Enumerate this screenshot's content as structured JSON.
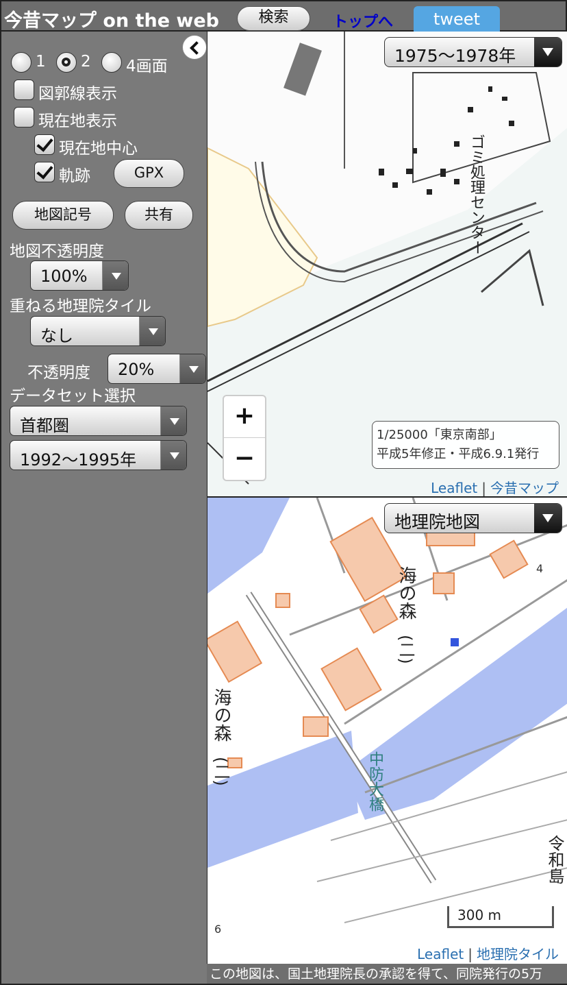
{
  "header": {
    "title": "今昔マップ on the web",
    "search_label": "検索",
    "top_link_label": "トップへ",
    "tweet_label": "tweet"
  },
  "sidebar": {
    "screen_options": [
      "1",
      "2",
      "4画面"
    ],
    "selected_screens": "2",
    "graticule_label": "図郭線表示",
    "graticule_checked": false,
    "location_label": "現在地表示",
    "location_checked": false,
    "center_label": "現在地中心",
    "center_checked": true,
    "track_label": "軌跡",
    "track_checked": true,
    "gpx_label": "GPX",
    "map_symbols_label": "地図記号",
    "share_label": "共有",
    "opacity_heading": "地図不透明度",
    "opacity_value": "100%",
    "overlay_heading": "重ねる地理院タイル",
    "overlay_value": "なし",
    "overlay_opacity_label": "不透明度",
    "overlay_opacity_value": "20%",
    "dataset_heading": "データセット選択",
    "dataset_value": "首都圏",
    "period_value": "1992〜1995年"
  },
  "map_top": {
    "period_select": "1975〜1978年",
    "info_line1": "1/25000「東京南部」",
    "info_line2": "平成5年修正・平成6.9.1発行",
    "attribution_leaflet": "Leaflet",
    "attribution_source": "今昔マップ",
    "zoom_in": "+",
    "zoom_out": "−",
    "label_center": "ゴミ処理センター"
  },
  "map_bottom": {
    "layer_select": "地理院地図",
    "scale_label": "300 m",
    "attribution_leaflet": "Leaflet",
    "attribution_source": "地理院タイル",
    "label_umi1": "海の森",
    "label_umi1_sub": "(二)",
    "label_umi2": "海の森",
    "label_umi2_sub": "(二)",
    "label_bridge": "中防大橋",
    "label_reiwa": "令和島",
    "spot_4": "4",
    "spot_6": "6"
  },
  "footer_note": "この地図は、国土地理院長の承認を得て、同院発行の5万",
  "colors": {
    "header_bg": "#6d6d6d",
    "sidebar_bg": "#7a7a7a",
    "tweet_bg": "#55a6e2",
    "link_blue": "#0000c8",
    "water_blue": "#aebff3",
    "building_orange": "#f3b089"
  }
}
